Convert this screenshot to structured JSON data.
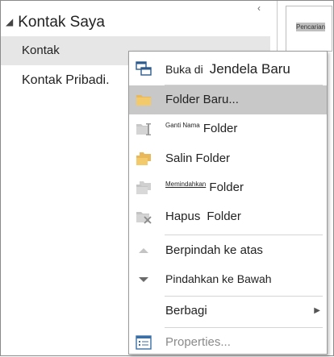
{
  "sidebar": {
    "collapse_glyph": "‹",
    "group_title": "Kontak Saya",
    "group_toggle_glyph": "◢",
    "items": [
      {
        "label": "Kontak"
      },
      {
        "label": "Kontak Pribadi."
      }
    ]
  },
  "search": {
    "highlight": "Pencarian"
  },
  "menu": {
    "items": [
      {
        "label_a": "Buka di",
        "label_b": "Jendela Baru",
        "icon": "window-icon"
      },
      {
        "label": "Folder Baru...",
        "icon": "folder-icon"
      },
      {
        "label_small": "Ganti Nama",
        "label": "Folder",
        "icon": "rename-folder-icon"
      },
      {
        "label": "Salin Folder",
        "icon": "copy-folder-icon"
      },
      {
        "label_small": "Memindahkan",
        "label": "Folder",
        "icon": "move-folder-icon"
      },
      {
        "label_a": "Hapus",
        "label_b": "Folder",
        "icon": "delete-folder-icon"
      },
      {
        "label": "Berpindah ke atas",
        "icon": "arrow-up-icon"
      },
      {
        "label": "Pindahkan ke Bawah",
        "icon": "arrow-down-icon"
      },
      {
        "label": "Berbagi",
        "icon": "none",
        "submenu_glyph": "▶"
      },
      {
        "label": "Properties...",
        "icon": "properties-icon"
      }
    ]
  },
  "colors": {
    "folder": "#e8b85a",
    "hover": "#c8c8c8",
    "disabled_icon": "#bcbcbc"
  }
}
